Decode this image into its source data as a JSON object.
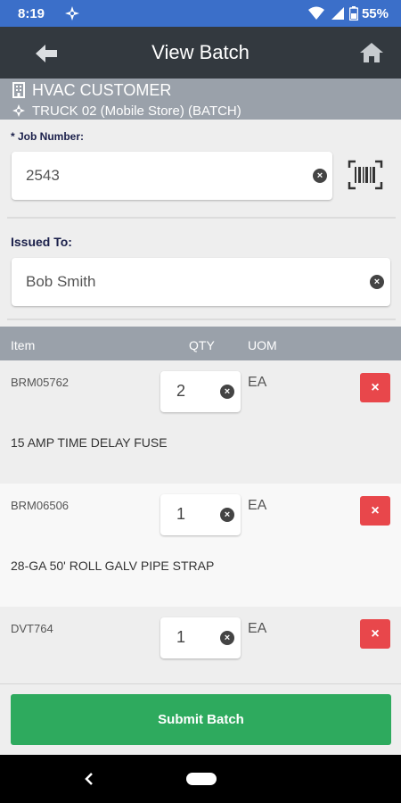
{
  "status_bar": {
    "time": "8:19",
    "battery": "55%"
  },
  "app_bar": {
    "title": "View Batch"
  },
  "customer": {
    "name": "HVAC CUSTOMER",
    "truck": "TRUCK 02 (Mobile Store)  (BATCH)"
  },
  "job_number": {
    "label": "* Job Number:",
    "value": "2543"
  },
  "issued_to": {
    "label": "Issued To:",
    "value": "Bob Smith"
  },
  "table": {
    "headers": {
      "item": "Item",
      "qty": "QTY",
      "uom": "UOM"
    },
    "rows": [
      {
        "code": "BRM05762",
        "qty": "2",
        "uom": "EA",
        "description": "15 AMP TIME DELAY FUSE",
        "delete_glyph": "×"
      },
      {
        "code": "BRM06506",
        "qty": "1",
        "uom": "EA",
        "description": "28-GA 50' ROLL GALV PIPE STRAP",
        "delete_glyph": "×"
      },
      {
        "code": "DVT764",
        "qty": "1",
        "uom": "EA",
        "description": "",
        "delete_glyph": "×"
      }
    ]
  },
  "submit": {
    "label": "Submit Batch"
  },
  "colors": {
    "status_bar": "#3b6fc9",
    "app_bar": "#33393f",
    "header_gray": "#9aa1aa",
    "delete_red": "#e8474b",
    "submit_green": "#2eaa5e"
  },
  "icons": [
    "back-arrow-icon",
    "home-icon",
    "building-icon",
    "location-target-icon",
    "barcode-scanner-icon",
    "clear-icon",
    "delete-icon"
  ]
}
